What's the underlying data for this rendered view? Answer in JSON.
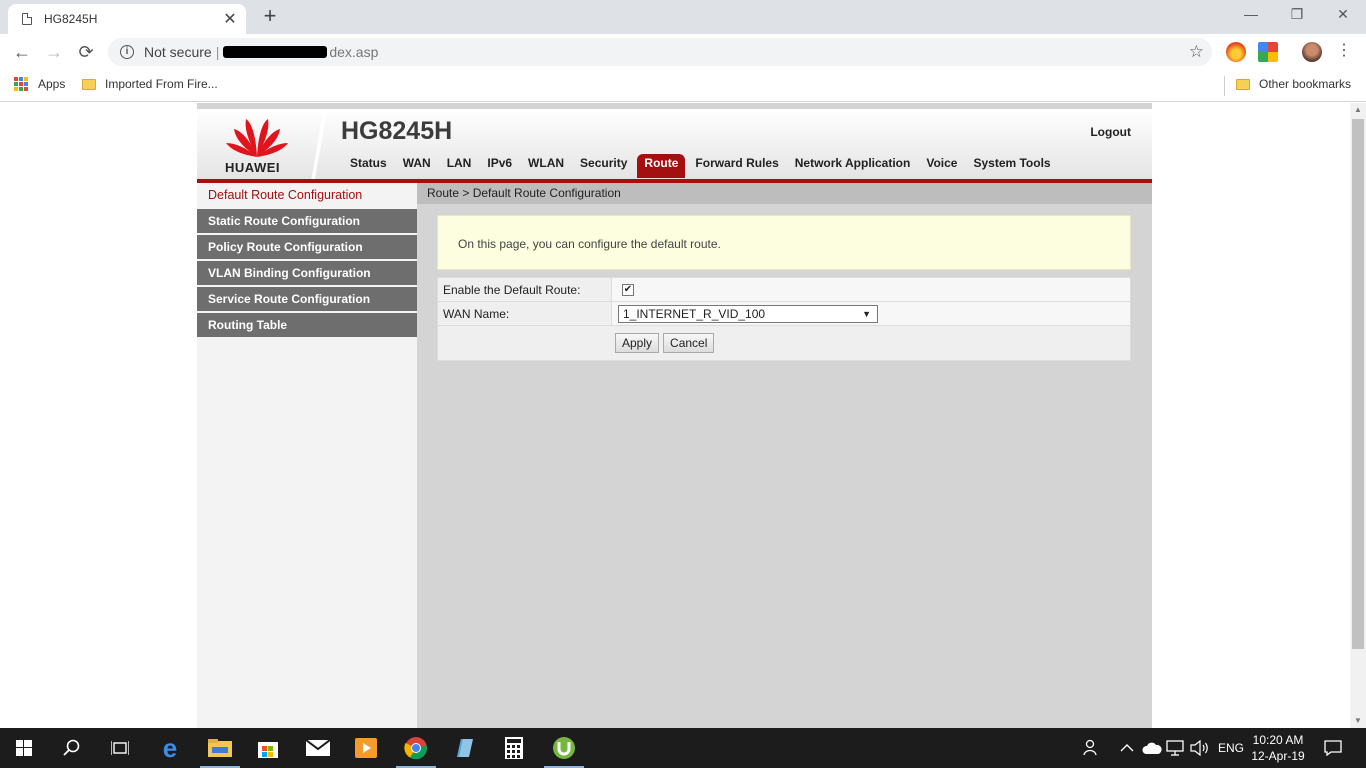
{
  "browser": {
    "tab_title": "HG8245H",
    "tab_close": "✕",
    "new_tab": "+",
    "window_buttons": [
      "—",
      "❐",
      "✕"
    ],
    "security_label": "Not secure",
    "url_separator": "|",
    "url_tail": "dex.asp",
    "bookmarks": {
      "apps": "Apps",
      "imported": "Imported From Fire...",
      "other": "Other bookmarks"
    }
  },
  "router": {
    "brand": "HUAWEI",
    "model": "HG8245H",
    "logout": "Logout",
    "nav": [
      "Status",
      "WAN",
      "LAN",
      "IPv6",
      "WLAN",
      "Security",
      "Route",
      "Forward Rules",
      "Network Application",
      "Voice",
      "System Tools"
    ],
    "active_nav": "Route",
    "sidebar": [
      "Default Route Configuration",
      "Static Route Configuration",
      "Policy Route Configuration",
      "VLAN Binding Configuration",
      "Service Route Configuration",
      "Routing Table"
    ],
    "breadcrumb": "Route > Default Route Configuration",
    "notice": "On this page, you can configure the default route.",
    "form": {
      "enable_label": "Enable the Default Route:",
      "enable_checked": true,
      "wan_label": "WAN Name:",
      "wan_value": "1_INTERNET_R_VID_100",
      "apply": "Apply",
      "cancel": "Cancel"
    },
    "brand_color": "#a40f0f"
  },
  "taskbar": {
    "lang": "ENG",
    "time": "10:20 AM",
    "date": "12-Apr-19"
  }
}
